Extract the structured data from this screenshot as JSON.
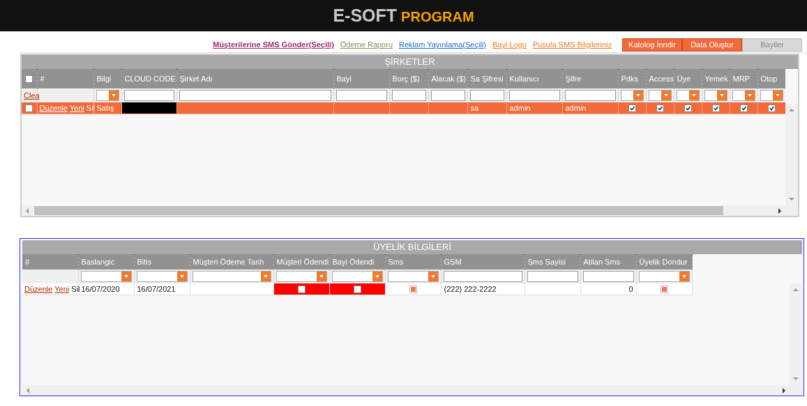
{
  "header": {
    "title_main": "E-SOFT",
    "title_accent": "PROGRAM"
  },
  "links": [
    {
      "text": "Müşterilerine SMS Gönder(Seçili)",
      "color": "#a0307a",
      "bold": true
    },
    {
      "text": "Ödeme Raporu",
      "color": "#8a8a5a",
      "bold": false
    },
    {
      "text": "Reklam Yayınlama(Seçili)",
      "color": "#1a6ad0",
      "bold": false
    },
    {
      "text": "Bayi Logo",
      "color": "#f07a20",
      "bold": false
    },
    {
      "text": "Pusula SMS Bilgileriniz",
      "color": "#f07a20",
      "bold": false
    }
  ],
  "buttons": [
    {
      "label": "Katolog İnndir",
      "disabled": false
    },
    {
      "label": "Data Oluştur",
      "disabled": false
    },
    {
      "label": "Bayiler",
      "disabled": true
    }
  ],
  "companies": {
    "title": "ŞİRKETLER",
    "columns": [
      {
        "kind": "checkbox",
        "checked": false
      },
      {
        "kind": "label",
        "label": "#"
      },
      {
        "kind": "label",
        "label": "Bilgi"
      },
      {
        "kind": "label",
        "label": "CLOUD CODE"
      },
      {
        "kind": "label",
        "label": "Şirket Adı"
      },
      {
        "kind": "label",
        "label": "Bayi"
      },
      {
        "kind": "label",
        "label": "Borç ($)"
      },
      {
        "kind": "label",
        "label": "Alacak ($)"
      },
      {
        "kind": "label",
        "label": "Sa Şifresi"
      },
      {
        "kind": "label",
        "label": "Kullanıcı"
      },
      {
        "kind": "label",
        "label": "Şifre"
      },
      {
        "kind": "label",
        "label": "Pdks"
      },
      {
        "kind": "label",
        "label": "Access"
      },
      {
        "kind": "label",
        "label": "Üye"
      },
      {
        "kind": "label",
        "label": "Yemek"
      },
      {
        "kind": "label",
        "label": "MRP"
      },
      {
        "kind": "label",
        "label": "Otop"
      }
    ],
    "filters": [
      {
        "kind": "link",
        "text": "Clea"
      },
      {
        "kind": "empty"
      },
      {
        "kind": "select"
      },
      {
        "kind": "input"
      },
      {
        "kind": "input"
      },
      {
        "kind": "input"
      },
      {
        "kind": "input"
      },
      {
        "kind": "input"
      },
      {
        "kind": "input"
      },
      {
        "kind": "input"
      },
      {
        "kind": "input"
      },
      {
        "kind": "select"
      },
      {
        "kind": "select"
      },
      {
        "kind": "select"
      },
      {
        "kind": "select"
      },
      {
        "kind": "select"
      },
      {
        "kind": "select"
      }
    ],
    "rows": [
      {
        "selected": true,
        "cells": [
          {
            "kind": "checkbox",
            "checked": false
          },
          {
            "kind": "actions",
            "items": [
              {
                "text": "Düzenle",
                "link": true
              },
              {
                "text": "Yeni",
                "link": true
              },
              {
                "text": "Sil",
                "link": false
              }
            ]
          },
          {
            "kind": "text",
            "text": "Satış"
          },
          {
            "kind": "masked"
          },
          {
            "kind": "empty"
          },
          {
            "kind": "empty"
          },
          {
            "kind": "empty"
          },
          {
            "kind": "empty"
          },
          {
            "kind": "text",
            "text": "sa"
          },
          {
            "kind": "text",
            "text": "admin"
          },
          {
            "kind": "text",
            "text": "admin"
          },
          {
            "kind": "checkbox",
            "checked": true
          },
          {
            "kind": "checkbox",
            "checked": true
          },
          {
            "kind": "checkbox",
            "checked": true
          },
          {
            "kind": "checkbox",
            "checked": true
          },
          {
            "kind": "checkbox",
            "checked": true
          },
          {
            "kind": "checkbox",
            "checked": true
          }
        ]
      }
    ]
  },
  "membership": {
    "title": "ÜYELİK BİLGİLERİ",
    "columns": [
      {
        "kind": "label",
        "label": "#"
      },
      {
        "kind": "label",
        "label": "Baslangic"
      },
      {
        "kind": "label",
        "label": "Bitis"
      },
      {
        "kind": "label",
        "label": "Müşteri Ödeme Tarih"
      },
      {
        "kind": "label",
        "label": "Müşteri Ödendi"
      },
      {
        "kind": "label",
        "label": "Bayi Ödendi"
      },
      {
        "kind": "label",
        "label": "Sms"
      },
      {
        "kind": "label",
        "label": "GSM"
      },
      {
        "kind": "label",
        "label": "Sms Sayisi"
      },
      {
        "kind": "label",
        "label": "Atilan Sms"
      },
      {
        "kind": "label",
        "label": "Üyelik Dondur"
      }
    ],
    "filters": [
      {
        "kind": "empty"
      },
      {
        "kind": "select"
      },
      {
        "kind": "select"
      },
      {
        "kind": "select"
      },
      {
        "kind": "select"
      },
      {
        "kind": "select"
      },
      {
        "kind": "select"
      },
      {
        "kind": "input"
      },
      {
        "kind": "input"
      },
      {
        "kind": "input"
      },
      {
        "kind": "select"
      }
    ],
    "rows": [
      {
        "selected": false,
        "cells": [
          {
            "kind": "actions",
            "items": [
              {
                "text": "Düzenle",
                "link": true
              },
              {
                "text": "Yeni",
                "link": true
              },
              {
                "text": "Sil",
                "link": false
              }
            ]
          },
          {
            "kind": "text",
            "text": "16/07/2020"
          },
          {
            "kind": "text",
            "text": "16/07/2021"
          },
          {
            "kind": "empty"
          },
          {
            "kind": "checkbox",
            "checked": false,
            "alert": true
          },
          {
            "kind": "checkbox",
            "checked": false,
            "alert": true
          },
          {
            "kind": "square"
          },
          {
            "kind": "text",
            "text": "(222) 222-2222"
          },
          {
            "kind": "empty"
          },
          {
            "kind": "number",
            "text": "0"
          },
          {
            "kind": "square"
          }
        ]
      }
    ]
  }
}
